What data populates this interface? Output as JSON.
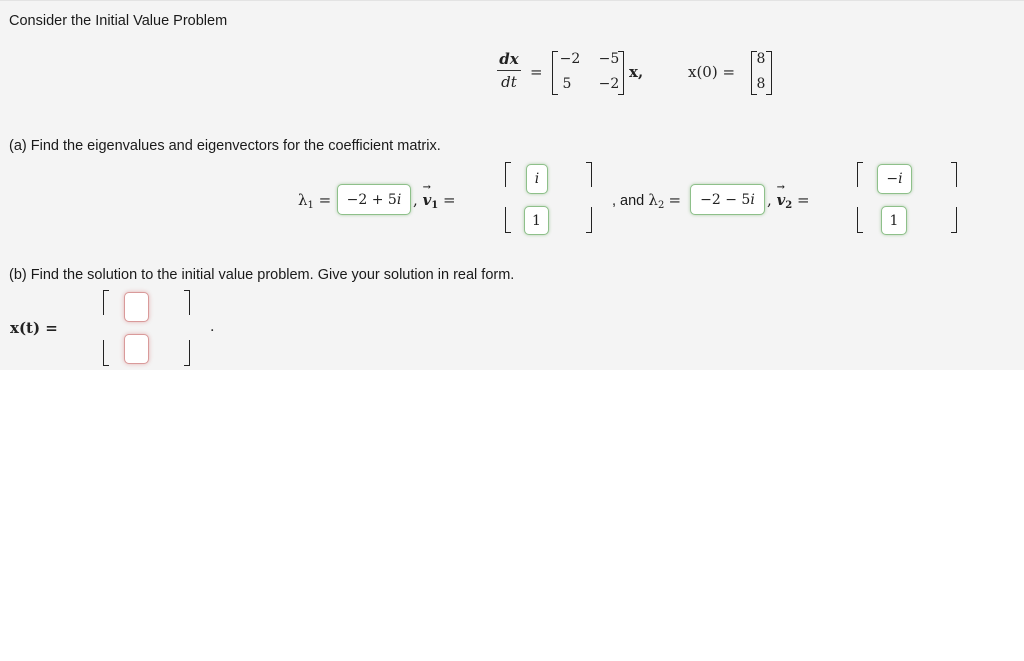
{
  "intro": "Consider the Initial Value Problem",
  "ode": {
    "lhs_num": "dx",
    "lhs_den": "dt",
    "equals": "=",
    "matrix": [
      [
        "−2",
        "−5"
      ],
      [
        "5",
        "−2"
      ]
    ],
    "times": "x,",
    "ic_label": "x(0) =",
    "ic_vector": [
      "8",
      "8"
    ]
  },
  "part_a": {
    "prompt": "(a) Find the eigenvalues and eigenvectors for the coefficient matrix.",
    "lambda1_label": "λ",
    "lambda1_sub": "1",
    "lambda1_value": "−2 + 5i",
    "v1_label": "v",
    "v1_sub": "1",
    "v1_values": [
      "i",
      "1"
    ],
    "and_text": ", and",
    "lambda2_label": "λ",
    "lambda2_sub": "2",
    "lambda2_value": "−2 − 5i",
    "v2_label": "v",
    "v2_sub": "2",
    "v2_values": [
      "−i",
      "1"
    ],
    "comma": ",",
    "equals": "="
  },
  "part_b": {
    "prompt": "(b) Find the solution to the initial value problem. Give your solution in real form.",
    "xt_label": "x(t) =",
    "xt_values": [
      "",
      ""
    ],
    "period": "."
  }
}
